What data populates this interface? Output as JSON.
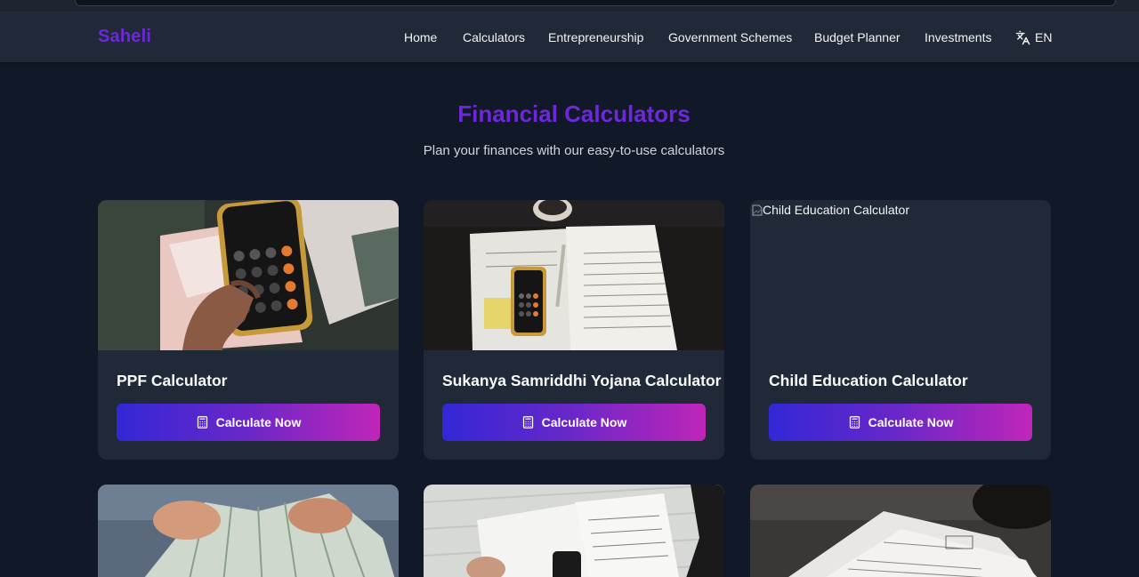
{
  "brand": "Saheli",
  "nav": {
    "items": [
      {
        "label": "Home"
      },
      {
        "label": "Calculators"
      },
      {
        "label": "Entrepreneurship"
      },
      {
        "label": "Government Schemes"
      },
      {
        "label": "Budget Planner"
      },
      {
        "label": "Investments"
      }
    ],
    "language": {
      "label": "EN",
      "icon": "translate-icon"
    }
  },
  "page": {
    "title": "Financial Calculators",
    "subtitle": "Plan your finances with our easy-to-use calculators"
  },
  "cards": [
    {
      "title": "PPF Calculator",
      "button_label": "Calculate Now",
      "image": "photo-calculator-phone-hand",
      "button_icon": "calculator-icon"
    },
    {
      "title": "Sukanya Samriddhi Yojana Calculator",
      "button_label": "Calculate Now",
      "image": "photo-tax-forms-phone",
      "button_icon": "calculator-icon"
    },
    {
      "title": "Child Education Calculator",
      "button_label": "Calculate Now",
      "image_alt": "Child Education Calculator",
      "button_icon": "calculator-icon"
    }
  ],
  "lower_cards": [
    {
      "image": "photo-hands-counting-cash"
    },
    {
      "image": "photo-tax-documents-desk"
    },
    {
      "image": "photo-tax-withholding-form"
    }
  ],
  "colors": {
    "background": "#111827",
    "navbar": "#1f2937",
    "card": "#1f2937",
    "brand": "#6d28d9",
    "button_gradient_start": "#3327d6",
    "button_gradient_end": "#c026b8"
  }
}
